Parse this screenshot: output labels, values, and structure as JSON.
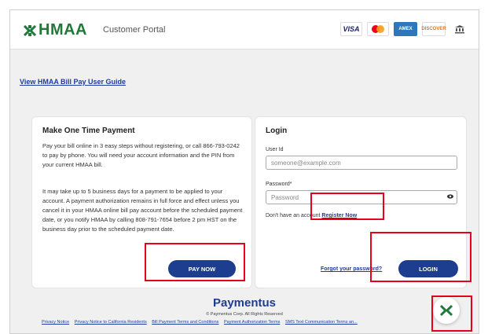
{
  "header": {
    "brand": "HMAA",
    "portal_label": "Customer Portal",
    "payment_cards": [
      "VISA",
      "MASTERCARD",
      "AMEX",
      "DISCOVER",
      "bank-icon"
    ]
  },
  "guide_link": "View HMAA Bill Pay User Guide",
  "one_time": {
    "title": "Make One Time Payment",
    "para1": "Pay your bill online in 3 easy steps without registering, or call 866-793-0242 to pay by phone. You will need your account information and the PIN from your current HMAA bill.",
    "para2": "It may take up to 5 business days for a payment to be applied to your account. A payment authorization remains in full force and effect unless you cancel it in your HMAA online bill pay account before the scheduled payment date, or you notify HMAA by calling 808-791-7654 before 2 pm HST on the business day prior to the scheduled payment date.",
    "pay_button": "PAY NOW"
  },
  "login": {
    "title": "Login",
    "user_label": "User Id",
    "user_placeholder": "someone@example.com",
    "password_label": "Password*",
    "password_placeholder": "Password",
    "no_account_text": "Don't have an account",
    "register_link": "Register Now",
    "forgot_link": "Forgot your password?",
    "login_button": "LOGIN"
  },
  "footer": {
    "brand": "Paymentus",
    "copyright": "© Paymentus Corp. All Rights Reserved",
    "links": [
      "Privacy Notice",
      "Privacy Notice to California Residents",
      "Bill Payment Terms and Conditions",
      "Payment Authorization Terms",
      "SMS Text Communication Terms an..."
    ]
  },
  "colors": {
    "brand_green": "#1f7a3a",
    "button_blue": "#1d3e8f",
    "link_blue": "#1b3d9e",
    "highlight_red": "#e5001b"
  }
}
